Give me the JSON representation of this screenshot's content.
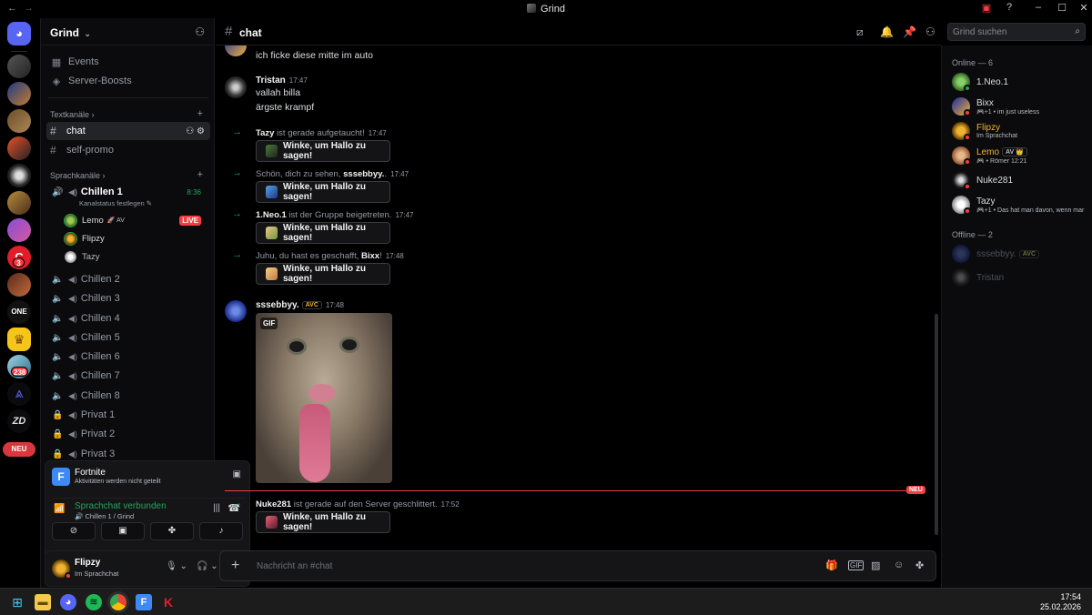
{
  "window": {
    "title": "Grind",
    "back": "←",
    "forward": "→"
  },
  "guild": {
    "name": "Grind",
    "chevron": "⌄"
  },
  "sidebar": {
    "top_items": [
      {
        "label": "Events",
        "icon": "calendar-icon"
      },
      {
        "label": "Server-Boosts",
        "icon": "boost-icon"
      }
    ],
    "text_category": "Textkanäle ›",
    "text_channels": [
      {
        "name": "chat",
        "active": true
      },
      {
        "name": "self-promo",
        "active": false
      }
    ],
    "voice_category": "Sprachkanäle ›",
    "active_voice": {
      "name": "Chillen 1",
      "timer": "8:36",
      "status": "Kanalstatus festlegen ✎"
    },
    "voice_users": [
      {
        "name": "Lemo",
        "tag": "🚀 AV",
        "live": "LIVE"
      },
      {
        "name": "Flipzy"
      },
      {
        "name": "Tazy"
      }
    ],
    "voice_channels": [
      "Chillen 2",
      "Chillen 3",
      "Chillen 4",
      "Chillen 5",
      "Chillen 6",
      "Chillen 7",
      "Chillen 8",
      "Privat 1",
      "Privat 2",
      "Privat 3"
    ]
  },
  "rail": {
    "badges": [
      "3",
      "238"
    ],
    "neu": "NEU"
  },
  "activity": {
    "game": "Fortnite",
    "game_sub": "Aktivitäten werden nicht geteilt",
    "voice_status": "Sprachchat verbunden",
    "voice_location": "Chillen 1 / Grind"
  },
  "user": {
    "name": "Flipzy",
    "status": "Im Sprachchat"
  },
  "chat": {
    "channel": "chat",
    "search_placeholder": "Grind suchen",
    "composer_placeholder": "Nachricht an #chat",
    "top_partial": "ich ficke diese mitte im auto",
    "messages": [
      {
        "author": "Tristan",
        "time": "17:47",
        "lines": [
          "vallah billa",
          "ärgste krampf"
        ]
      }
    ],
    "system": [
      {
        "pre": "",
        "name": "Tazy",
        "post": " ist gerade aufgetaucht!",
        "time": "17:47",
        "button": "Winke, um Hallo zu sagen!"
      },
      {
        "pre": "Schön, dich zu sehen, ",
        "name": "sssebbyy.",
        "post": ".",
        "time": "17:47",
        "button": "Winke, um Hallo zu sagen!"
      },
      {
        "pre": "",
        "name": "1.Neo.1",
        "post": " ist der Gruppe beigetreten.",
        "time": "17:47",
        "button": "Winke, um Hallo zu sagen!"
      },
      {
        "pre": "Juhu, du hast es geschafft, ",
        "name": "Bixx",
        "post": "!",
        "time": "17:48",
        "button": "Winke, um Hallo zu sagen!"
      }
    ],
    "gif_message": {
      "author": "sssebbyy.",
      "tag": "AVC",
      "time": "17:48",
      "gif_label": "GIF"
    },
    "new_divider": "NEU",
    "last_system": {
      "name": "Nuke281",
      "post": " ist gerade auf den Server geschlittert.",
      "time": "17:52",
      "button": "Winke, um Hallo zu sagen!"
    }
  },
  "members": {
    "online_header": "Online — 6",
    "online": [
      {
        "name": "1.Neo.1",
        "status": "",
        "color": "#dbdee1",
        "dot": "#23a55a"
      },
      {
        "name": "Bixx",
        "status": "🎮+1 • im just useless",
        "color": "#dbdee1",
        "dot": "#f23f43"
      },
      {
        "name": "Flipzy",
        "status": "Im Sprachchat",
        "color": "#f0b232",
        "dot": "#f23f43"
      },
      {
        "name": "Lemo",
        "status": "🎮 • Römer 12:21",
        "color": "#f0b232",
        "dot": "#f23f43",
        "tag": "AV 👑"
      },
      {
        "name": "Nuke281",
        "status": "",
        "color": "#dbdee1",
        "dot": "#f23f43"
      },
      {
        "name": "Tazy",
        "status": "🎮+1 • Das hat man davon, wenn mar",
        "color": "#dbdee1",
        "dot": "#f23f43"
      }
    ],
    "offline_header": "Offline — 2",
    "offline": [
      {
        "name": "sssebbyy.",
        "tag": "AVC"
      },
      {
        "name": "Tristan"
      }
    ]
  },
  "taskbar": {
    "time": "17:54",
    "date": "25.02.2026"
  }
}
